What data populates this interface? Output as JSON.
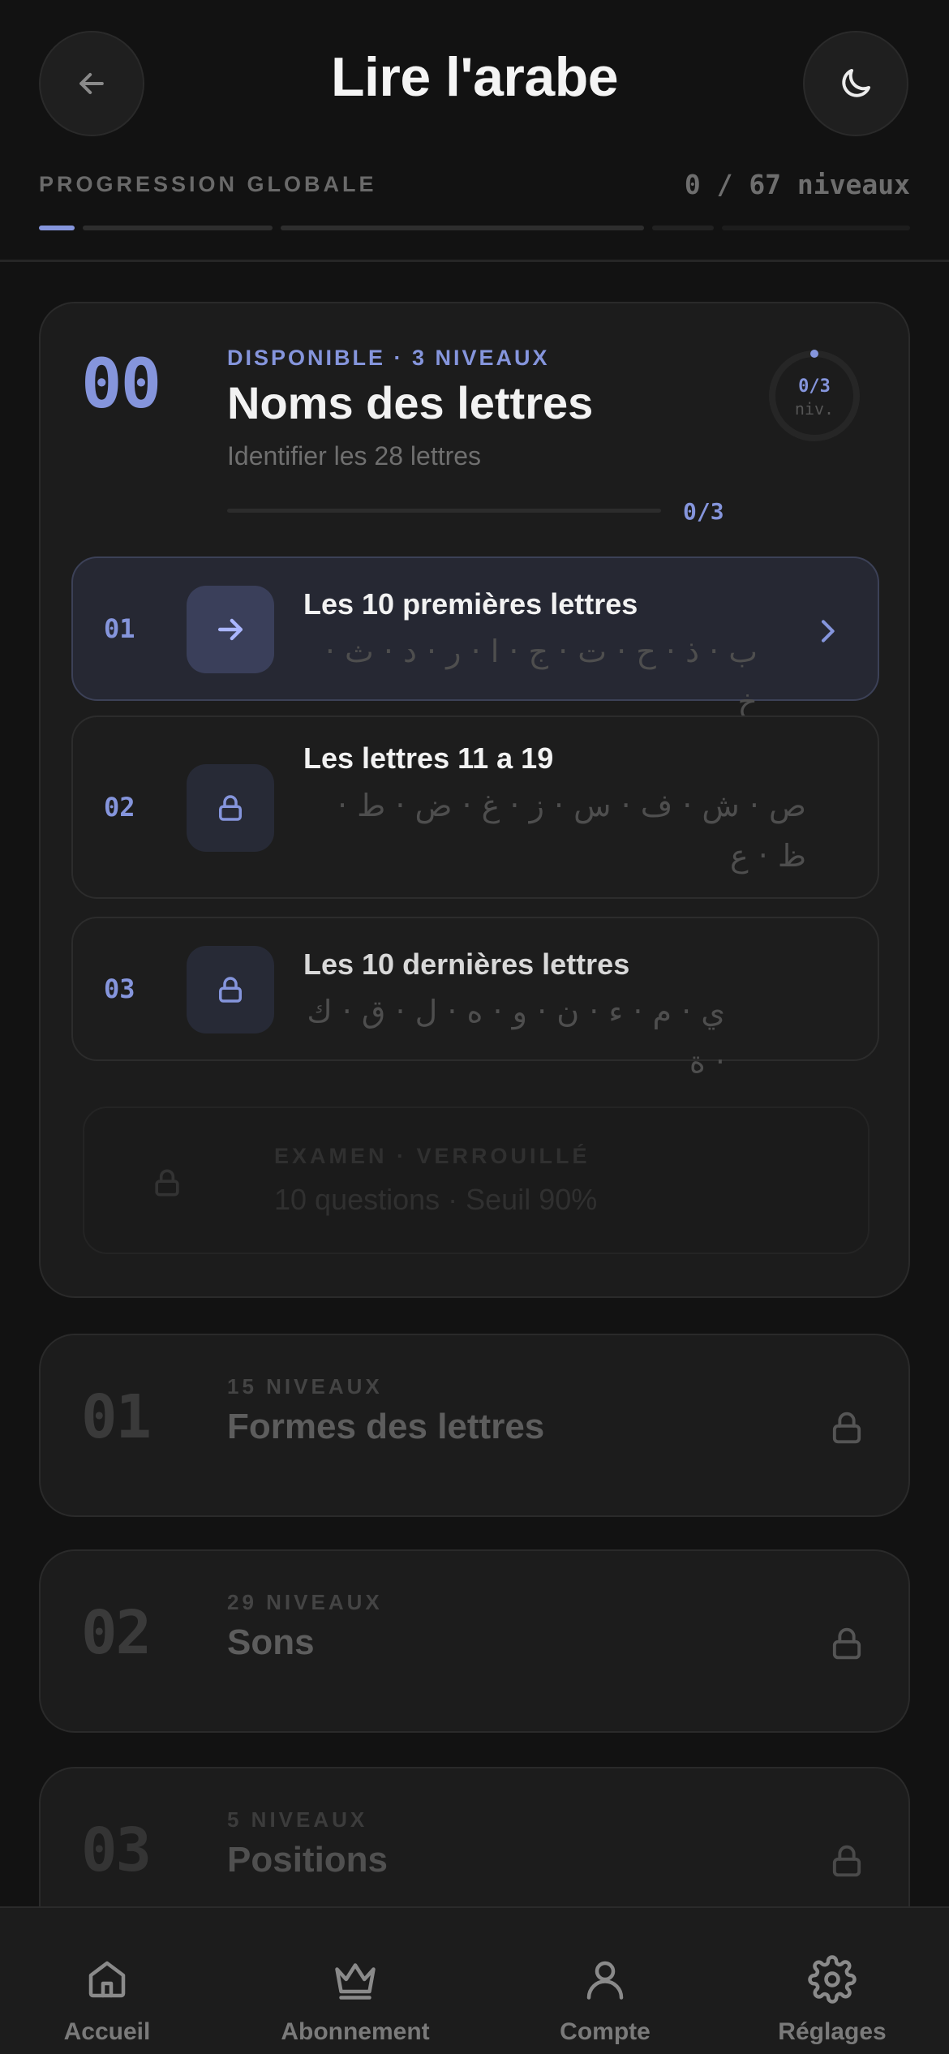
{
  "header": {
    "title": "Lire l'arabe",
    "back_icon": "arrow-left-icon",
    "theme_icon": "moon-icon"
  },
  "progress": {
    "label": "PROGRESSION GLOBALE",
    "count": "0 / 67 niveaux",
    "completed": 0,
    "total": 67
  },
  "colors": {
    "accent": "#8595dc",
    "background": "#121212",
    "card": "#1c1c1c"
  },
  "unit_main": {
    "number": "00",
    "eyebrow": "DISPONIBLE · 3 NIVEAUX",
    "title": "Noms des lettres",
    "subtitle": "Identifier les 28 lettres",
    "mini_count": "0/3",
    "ring_value": "0/3",
    "ring_unit": "niv.",
    "lessons": [
      {
        "num": "01",
        "title": "Les 10 premières lettres",
        "letters": "ب · ذ · ح · ت · ج · ا · ر · د · ث · خ",
        "icon": "arrow-right-icon",
        "state": "active"
      },
      {
        "num": "02",
        "title": "Les lettres 11 a 19",
        "letters": "ص · ش · ف · س · ز · غ · ض · ط · ظ · ع",
        "icon": "lock-icon",
        "state": "locked"
      },
      {
        "num": "03",
        "title": "Les 10 dernières lettres",
        "letters": "ي · م · ء · ن · و · ه · ل · ق · ك · ة",
        "icon": "lock-icon",
        "state": "locked"
      }
    ],
    "exam": {
      "eyebrow": "EXAMEN · VERROUILLÉ",
      "text": "10 questions · Seuil 90%"
    }
  },
  "units": [
    {
      "number": "01",
      "eyebrow": "15 NIVEAUX",
      "title": "Formes des lettres"
    },
    {
      "number": "02",
      "eyebrow": "29 NIVEAUX",
      "title": "Sons"
    },
    {
      "number": "03",
      "eyebrow": "5 NIVEAUX",
      "title": "Positions"
    }
  ],
  "nav": [
    {
      "label": "Accueil",
      "icon": "home-icon"
    },
    {
      "label": "Abonnement",
      "icon": "crown-icon"
    },
    {
      "label": "Compte",
      "icon": "user-icon"
    },
    {
      "label": "Réglages",
      "icon": "gear-icon"
    }
  ]
}
